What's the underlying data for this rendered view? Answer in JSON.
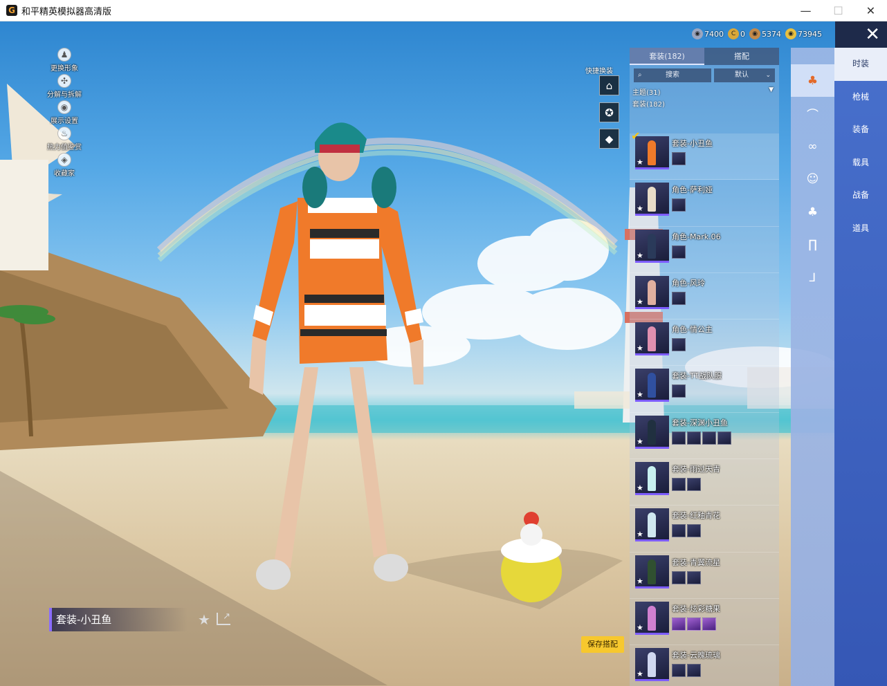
{
  "window": {
    "title": "和平精英模拟器高清版",
    "logo_letter": "G",
    "minimize": "—",
    "maximize": "☐",
    "close": "✕"
  },
  "left_menu": [
    {
      "label": "更换形象",
      "icon": "person-icon",
      "glyph": "♟"
    },
    {
      "label": "分解与拆解",
      "icon": "dismantle-icon",
      "glyph": "✣"
    },
    {
      "label": "展示设置",
      "icon": "eye-icon",
      "glyph": "◉"
    },
    {
      "label": "热力值鉴赏",
      "icon": "flame-icon",
      "glyph": "♨"
    },
    {
      "label": "收藏家",
      "icon": "collector-icon",
      "glyph": "◈"
    }
  ],
  "quick_change": {
    "label": "快捷换装",
    "buttons": [
      {
        "icon": "wardrobe-icon",
        "glyph": "⌂"
      },
      {
        "icon": "emblem-icon",
        "glyph": "✪"
      },
      {
        "icon": "diamond-icon",
        "glyph": "◆"
      }
    ]
  },
  "currencies": [
    {
      "icon": "silver-coin-icon",
      "value": "7400",
      "color": "#9aa6c0",
      "glyph": "◉"
    },
    {
      "icon": "gold-c-icon",
      "value": "0",
      "color": "#d9a83a",
      "glyph": "C"
    },
    {
      "icon": "bronze-coin-icon",
      "value": "5374",
      "color": "#c48a4a",
      "glyph": "◉"
    },
    {
      "icon": "gold-coin-icon",
      "value": "73945",
      "color": "#e8c040",
      "glyph": "◉"
    }
  ],
  "close_game": "✕",
  "panel": {
    "tabs": [
      {
        "label": "套装(182)",
        "active": true
      },
      {
        "label": "搭配",
        "active": false
      }
    ],
    "search_placeholder": "搜索",
    "sort_label": "默认",
    "theme_label": "主题(31)",
    "set_count_label": "套装(182)",
    "items": [
      {
        "name": "套装-小丑鱼",
        "selected": true,
        "color": "#f07a2a",
        "parts": 1,
        "purple_parts": 0
      },
      {
        "name": "角色-萨利娅",
        "selected": false,
        "color": "#e8dcc8",
        "parts": 1,
        "purple_parts": 0
      },
      {
        "name": "角色-Mark.06",
        "selected": false,
        "color": "#2a3a5a",
        "parts": 1,
        "purple_parts": 0
      },
      {
        "name": "角色-风玲",
        "selected": false,
        "color": "#e0b0a0",
        "parts": 1,
        "purple_parts": 0
      },
      {
        "name": "角色-情公主",
        "selected": false,
        "color": "#e090b0",
        "parts": 1,
        "purple_parts": 0
      },
      {
        "name": "套装-TT战队服",
        "selected": false,
        "color": "#3050a0",
        "parts": 1,
        "purple_parts": 0
      },
      {
        "name": "套装-深渊小丑鱼",
        "selected": false,
        "color": "#203040",
        "parts": 4,
        "purple_parts": 0
      },
      {
        "name": "套装-雨过天青",
        "selected": false,
        "color": "#c8f0f0",
        "parts": 2,
        "purple_parts": 0
      },
      {
        "name": "套装-红釉青花",
        "selected": false,
        "color": "#d0e8f0",
        "parts": 2,
        "purple_parts": 0
      },
      {
        "name": "套装-青翼流星",
        "selected": false,
        "color": "#305030",
        "parts": 2,
        "purple_parts": 0
      },
      {
        "name": "套装-炫彩糖果",
        "selected": false,
        "color": "#d080d0",
        "parts": 3,
        "purple_parts": 3
      },
      {
        "name": "套装-云魄琉璃",
        "selected": false,
        "color": "#d0d8f0",
        "parts": 2,
        "purple_parts": 0
      }
    ]
  },
  "category_icons": [
    {
      "icon": "outfit-icon",
      "glyph": "♣",
      "active": true
    },
    {
      "icon": "hat-icon",
      "glyph": "⌒",
      "active": false
    },
    {
      "icon": "glasses-icon",
      "glyph": "∞",
      "active": false
    },
    {
      "icon": "mask-icon",
      "glyph": "☺",
      "active": false
    },
    {
      "icon": "top-icon",
      "glyph": "♣",
      "active": false
    },
    {
      "icon": "pants-icon",
      "glyph": "∏",
      "active": false
    },
    {
      "icon": "shoes-icon",
      "glyph": "⅃",
      "active": false
    }
  ],
  "categories": [
    {
      "label": "时装",
      "active": true
    },
    {
      "label": "枪械",
      "active": false
    },
    {
      "label": "装备",
      "active": false
    },
    {
      "label": "载具",
      "active": false
    },
    {
      "label": "战备",
      "active": false
    },
    {
      "label": "道具",
      "active": false
    }
  ],
  "outfit_name": "套装-小丑鱼",
  "save_label": "保存搭配",
  "star_glyph": "★",
  "share_glyph": "↗",
  "accent_color": "#7d5cff"
}
